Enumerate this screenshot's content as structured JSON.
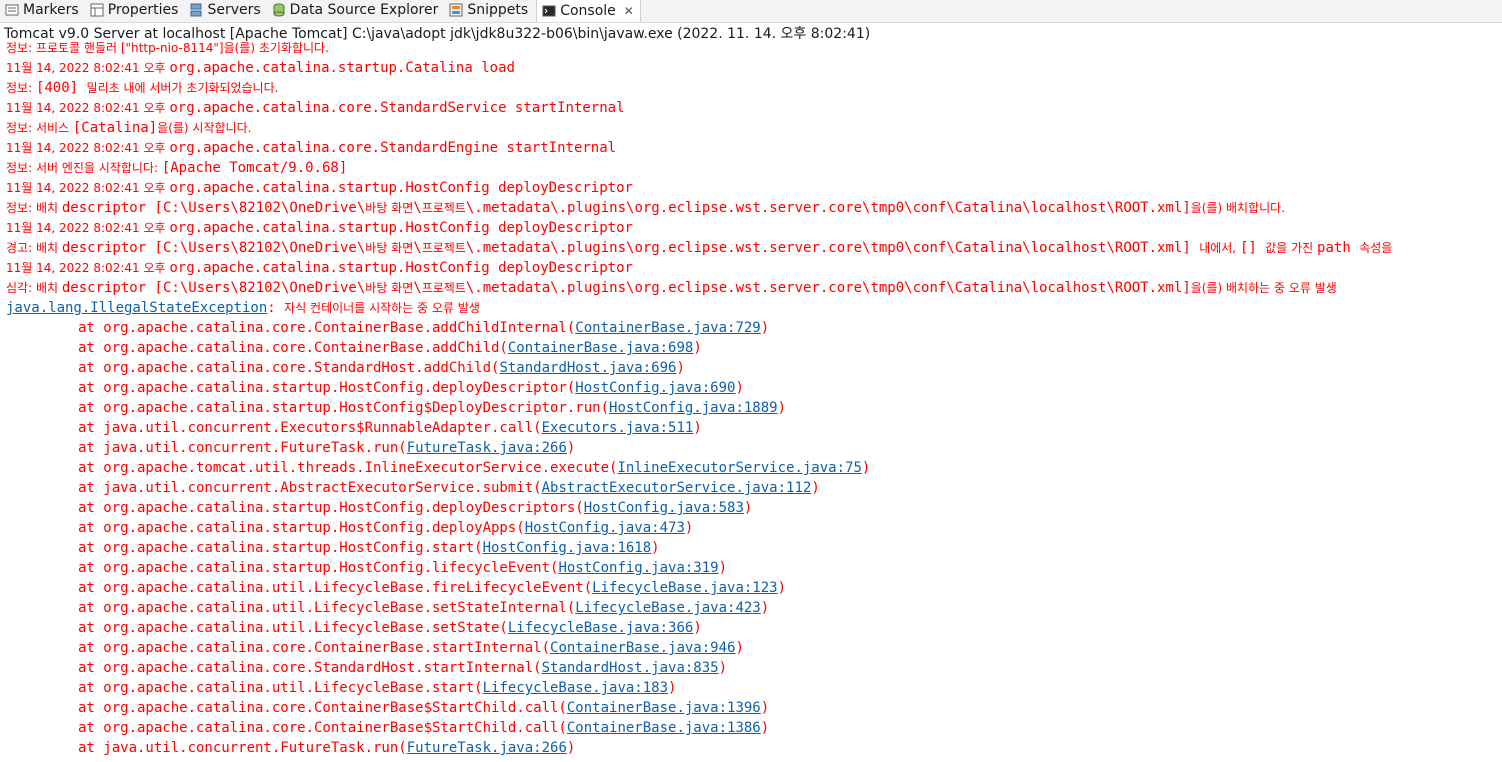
{
  "tabs": [
    {
      "label": "Markers",
      "icon": "markers-icon"
    },
    {
      "label": "Properties",
      "icon": "properties-icon"
    },
    {
      "label": "Servers",
      "icon": "servers-icon"
    },
    {
      "label": "Data Source Explorer",
      "icon": "data-source-icon"
    },
    {
      "label": "Snippets",
      "icon": "snippets-icon"
    },
    {
      "label": "Console",
      "icon": "console-icon",
      "active": true
    }
  ],
  "console_title": "Tomcat v9.0 Server at localhost [Apache Tomcat] C:\\java\\adopt jdk\\jdk8u322-b06\\bin\\javaw.exe  (2022. 11. 14. 오후 8:02:41)",
  "colors": {
    "error_text": "#ff0000",
    "link": "#0e5fad"
  },
  "lines": [
    {
      "parts": [
        {
          "t": "정보: 프로토콜 핸들러 [\"http-nio-8114\"]을(를) 초기화합니다.",
          "ko": true
        }
      ]
    },
    {
      "parts": [
        {
          "t": "11월 14, 2022 8:02:41 오후 ",
          "ko": true
        },
        {
          "t": "org.apache.catalina.startup.Catalina load"
        }
      ]
    },
    {
      "parts": [
        {
          "t": "정보: ",
          "ko": true
        },
        {
          "t": "[400] "
        },
        {
          "t": "밀리초 내에 서버가 초기화되었습니다.",
          "ko": true
        }
      ]
    },
    {
      "parts": [
        {
          "t": "11월 14, 2022 8:02:41 오후 ",
          "ko": true
        },
        {
          "t": "org.apache.catalina.core.StandardService startInternal"
        }
      ]
    },
    {
      "parts": [
        {
          "t": "정보: 서비스 ",
          "ko": true
        },
        {
          "t": "[Catalina]"
        },
        {
          "t": "을(를) 시작합니다.",
          "ko": true
        }
      ]
    },
    {
      "parts": [
        {
          "t": "11월 14, 2022 8:02:41 오후 ",
          "ko": true
        },
        {
          "t": "org.apache.catalina.core.StandardEngine startInternal"
        }
      ]
    },
    {
      "parts": [
        {
          "t": "정보: 서버 엔진을 시작합니다: ",
          "ko": true
        },
        {
          "t": "[Apache Tomcat/9.0.68]"
        }
      ]
    },
    {
      "parts": [
        {
          "t": "11월 14, 2022 8:02:41 오후 ",
          "ko": true
        },
        {
          "t": "org.apache.catalina.startup.HostConfig deployDescriptor"
        }
      ]
    },
    {
      "parts": [
        {
          "t": "정보: 배치 ",
          "ko": true
        },
        {
          "t": "descriptor [C:\\Users\\82102\\OneDrive\\"
        },
        {
          "t": "바탕 화면",
          "ko": true
        },
        {
          "t": "\\"
        },
        {
          "t": "프로젝트",
          "ko": true
        },
        {
          "t": "\\.metadata\\.plugins\\org.eclipse.wst.server.core\\tmp0\\conf\\Catalina\\localhost\\ROOT.xml]"
        },
        {
          "t": "을(를) 배치합니다.",
          "ko": true
        }
      ]
    },
    {
      "parts": [
        {
          "t": "11월 14, 2022 8:02:41 오후 ",
          "ko": true
        },
        {
          "t": "org.apache.catalina.startup.HostConfig deployDescriptor"
        }
      ]
    },
    {
      "parts": [
        {
          "t": "경고: 배치 ",
          "ko": true
        },
        {
          "t": "descriptor [C:\\Users\\82102\\OneDrive\\"
        },
        {
          "t": "바탕 화면",
          "ko": true
        },
        {
          "t": "\\"
        },
        {
          "t": "프로젝트",
          "ko": true
        },
        {
          "t": "\\.metadata\\.plugins\\org.eclipse.wst.server.core\\tmp0\\conf\\Catalina\\localhost\\ROOT.xml] "
        },
        {
          "t": "내에서, ",
          "ko": true
        },
        {
          "t": "[] "
        },
        {
          "t": "값을 가진 ",
          "ko": true
        },
        {
          "t": "path "
        },
        {
          "t": "속성을",
          "ko": true
        }
      ]
    },
    {
      "parts": [
        {
          "t": "11월 14, 2022 8:02:41 오후 ",
          "ko": true
        },
        {
          "t": "org.apache.catalina.startup.HostConfig deployDescriptor"
        }
      ]
    },
    {
      "parts": [
        {
          "t": "심각: 배치 ",
          "ko": true
        },
        {
          "t": "descriptor [C:\\Users\\82102\\OneDrive\\"
        },
        {
          "t": "바탕 화면",
          "ko": true
        },
        {
          "t": "\\"
        },
        {
          "t": "프로젝트",
          "ko": true
        },
        {
          "t": "\\.metadata\\.plugins\\org.eclipse.wst.server.core\\tmp0\\conf\\Catalina\\localhost\\ROOT.xml]"
        },
        {
          "t": "을(를) 배치하는 중 오류 발생",
          "ko": true
        }
      ]
    },
    {
      "parts": [
        {
          "t": "java.lang.IllegalStateException",
          "link": true
        },
        {
          "t": ": "
        },
        {
          "t": "자식 컨테이너를 시작하는 중 오류 발생",
          "ko": true
        }
      ]
    }
  ],
  "trace": [
    {
      "m": "at org.apache.catalina.core.ContainerBase.addChildInternal(",
      "l": "ContainerBase.java:729"
    },
    {
      "m": "at org.apache.catalina.core.ContainerBase.addChild(",
      "l": "ContainerBase.java:698"
    },
    {
      "m": "at org.apache.catalina.core.StandardHost.addChild(",
      "l": "StandardHost.java:696"
    },
    {
      "m": "at org.apache.catalina.startup.HostConfig.deployDescriptor(",
      "l": "HostConfig.java:690"
    },
    {
      "m": "at org.apache.catalina.startup.HostConfig$DeployDescriptor.run(",
      "l": "HostConfig.java:1889"
    },
    {
      "m": "at java.util.concurrent.Executors$RunnableAdapter.call(",
      "l": "Executors.java:511"
    },
    {
      "m": "at java.util.concurrent.FutureTask.run(",
      "l": "FutureTask.java:266"
    },
    {
      "m": "at org.apache.tomcat.util.threads.InlineExecutorService.execute(",
      "l": "InlineExecutorService.java:75"
    },
    {
      "m": "at java.util.concurrent.AbstractExecutorService.submit(",
      "l": "AbstractExecutorService.java:112"
    },
    {
      "m": "at org.apache.catalina.startup.HostConfig.deployDescriptors(",
      "l": "HostConfig.java:583"
    },
    {
      "m": "at org.apache.catalina.startup.HostConfig.deployApps(",
      "l": "HostConfig.java:473"
    },
    {
      "m": "at org.apache.catalina.startup.HostConfig.start(",
      "l": "HostConfig.java:1618"
    },
    {
      "m": "at org.apache.catalina.startup.HostConfig.lifecycleEvent(",
      "l": "HostConfig.java:319"
    },
    {
      "m": "at org.apache.catalina.util.LifecycleBase.fireLifecycleEvent(",
      "l": "LifecycleBase.java:123"
    },
    {
      "m": "at org.apache.catalina.util.LifecycleBase.setStateInternal(",
      "l": "LifecycleBase.java:423"
    },
    {
      "m": "at org.apache.catalina.util.LifecycleBase.setState(",
      "l": "LifecycleBase.java:366"
    },
    {
      "m": "at org.apache.catalina.core.ContainerBase.startInternal(",
      "l": "ContainerBase.java:946"
    },
    {
      "m": "at org.apache.catalina.core.StandardHost.startInternal(",
      "l": "StandardHost.java:835"
    },
    {
      "m": "at org.apache.catalina.util.LifecycleBase.start(",
      "l": "LifecycleBase.java:183"
    },
    {
      "m": "at org.apache.catalina.core.ContainerBase$StartChild.call(",
      "l": "ContainerBase.java:1396"
    },
    {
      "m": "at org.apache.catalina.core.ContainerBase$StartChild.call(",
      "l": "ContainerBase.java:1386"
    },
    {
      "m": "at java.util.concurrent.FutureTask.run(",
      "l": "FutureTask.java:266"
    }
  ]
}
